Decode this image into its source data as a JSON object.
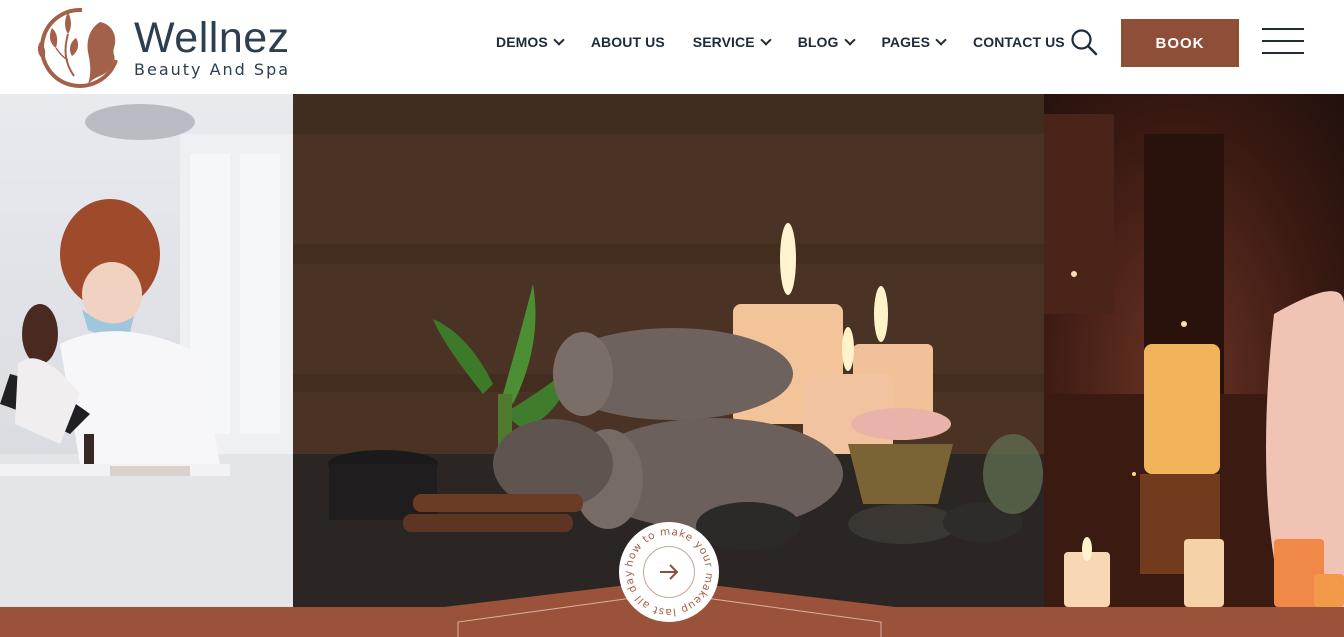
{
  "brand": {
    "name": "Wellnez",
    "tagline": "Beauty And Spa"
  },
  "nav": {
    "items": [
      {
        "label": "DEMOS",
        "has_dropdown": true
      },
      {
        "label": "ABOUT US",
        "has_dropdown": false
      },
      {
        "label": "SERVICE",
        "has_dropdown": true
      },
      {
        "label": "BLOG",
        "has_dropdown": true
      },
      {
        "label": "PAGES",
        "has_dropdown": true
      },
      {
        "label": "CONTACT US",
        "has_dropdown": false
      }
    ],
    "search_icon": "search-icon",
    "book_label": "BOOK",
    "menu_icon": "hamburger-menu-icon"
  },
  "hero": {
    "circle_text": "how to make your makeup last all day",
    "circle_icon": "arrow-right-icon"
  },
  "colors": {
    "brand": "#8e4e38",
    "band": "#9a533a",
    "text_dark": "#1f2b38",
    "logo_text": "#2c3e4f"
  }
}
